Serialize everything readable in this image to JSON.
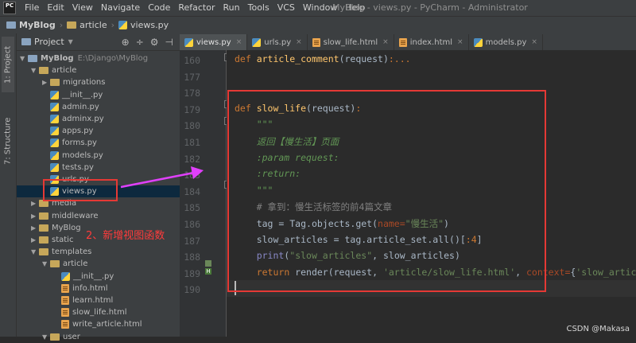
{
  "menubar": {
    "items": [
      "File",
      "Edit",
      "View",
      "Navigate",
      "Code",
      "Refactor",
      "Run",
      "Tools",
      "VCS",
      "Window",
      "Help"
    ],
    "window_title": "MyBlog - views.py - PyCharm - Administrator",
    "app_icon_label": "PC"
  },
  "navbar": {
    "crumbs": [
      "MyBlog",
      "article",
      "views.py"
    ]
  },
  "sidestrip": {
    "project_tab": "1: Project",
    "structure_tab": "7: Structure"
  },
  "project_panel": {
    "title": "Project",
    "tree": [
      {
        "label": "MyBlog",
        "hint": "E:\\Django\\MyBlog",
        "type": "folder",
        "expanded": true,
        "level": 0
      },
      {
        "label": "article",
        "type": "folder",
        "expanded": true,
        "level": 1
      },
      {
        "label": "migrations",
        "type": "folder",
        "expanded": false,
        "level": 2
      },
      {
        "label": "__init__.py",
        "type": "py",
        "level": 2
      },
      {
        "label": "admin.py",
        "type": "py",
        "level": 2
      },
      {
        "label": "adminx.py",
        "type": "py",
        "level": 2
      },
      {
        "label": "apps.py",
        "type": "py",
        "level": 2
      },
      {
        "label": "forms.py",
        "type": "py",
        "level": 2
      },
      {
        "label": "models.py",
        "type": "py",
        "level": 2
      },
      {
        "label": "tests.py",
        "type": "py",
        "level": 2
      },
      {
        "label": "urls.py",
        "type": "py",
        "level": 2
      },
      {
        "label": "views.py",
        "type": "py",
        "level": 2,
        "selected": true
      },
      {
        "label": "media",
        "type": "folder",
        "expanded": false,
        "level": 1
      },
      {
        "label": "middleware",
        "type": "folder",
        "expanded": false,
        "level": 1
      },
      {
        "label": "MyBlog",
        "type": "folder",
        "expanded": false,
        "level": 1
      },
      {
        "label": "static",
        "type": "folder",
        "expanded": false,
        "level": 1
      },
      {
        "label": "templates",
        "type": "folder",
        "expanded": true,
        "level": 1
      },
      {
        "label": "article",
        "type": "folder",
        "expanded": true,
        "level": 2
      },
      {
        "label": "__init__.py",
        "type": "py",
        "level": 3
      },
      {
        "label": "info.html",
        "type": "html",
        "level": 3
      },
      {
        "label": "learn.html",
        "type": "html",
        "level": 3
      },
      {
        "label": "slow_life.html",
        "type": "html",
        "level": 3
      },
      {
        "label": "write_article.html",
        "type": "html",
        "level": 3
      },
      {
        "label": "user",
        "type": "folder",
        "expanded": true,
        "level": 2
      }
    ]
  },
  "editor": {
    "tabs": [
      {
        "label": "views.py",
        "type": "py",
        "active": true
      },
      {
        "label": "urls.py",
        "type": "py",
        "active": false
      },
      {
        "label": "slow_life.html",
        "type": "html",
        "active": false
      },
      {
        "label": "index.html",
        "type": "html",
        "active": false
      },
      {
        "label": "models.py",
        "type": "py",
        "active": false
      }
    ],
    "line_numbers": [
      "160",
      "177",
      "178",
      "179",
      "180",
      "181",
      "182",
      "183",
      "184",
      "185",
      "186",
      "187",
      "188",
      "189",
      "190"
    ],
    "lines": [
      [
        {
          "t": "def ",
          "c": "kw"
        },
        {
          "t": "article_comment",
          "c": "fn"
        },
        {
          "t": "(request)",
          "c": ""
        },
        {
          "t": ":...",
          "c": "kw"
        }
      ],
      [],
      [],
      [
        {
          "t": "def ",
          "c": "kw"
        },
        {
          "t": "slow_life",
          "c": "fn"
        },
        {
          "t": "(request)",
          "c": ""
        },
        {
          "t": ":",
          "c": "kw"
        }
      ],
      [
        {
          "t": "    \"\"\"",
          "c": "doc"
        }
      ],
      [
        {
          "t": "    返回【慢生活】页面",
          "c": "doc"
        }
      ],
      [
        {
          "t": "    :param request:",
          "c": "doc"
        }
      ],
      [
        {
          "t": "    :return:",
          "c": "doc"
        }
      ],
      [
        {
          "t": "    \"\"\"",
          "c": "doc"
        }
      ],
      [
        {
          "t": "    # 拿到：慢生活标签的前4篇文章",
          "c": "cmt"
        }
      ],
      [
        {
          "t": "    tag ",
          "c": ""
        },
        {
          "t": "= ",
          "c": ""
        },
        {
          "t": "Tag.objects.get(",
          "c": ""
        },
        {
          "t": "name=",
          "c": "named"
        },
        {
          "t": "\"慢生活\"",
          "c": "str"
        },
        {
          "t": ")",
          "c": ""
        }
      ],
      [
        {
          "t": "    slow_articles = tag.article_set.all()[",
          "c": ""
        },
        {
          "t": ":4",
          "c": "kw"
        },
        {
          "t": "]",
          "c": ""
        }
      ],
      [
        {
          "t": "    ",
          "c": ""
        },
        {
          "t": "print",
          "c": "bi"
        },
        {
          "t": "(",
          "c": ""
        },
        {
          "t": "\"slow_articles\"",
          "c": "str"
        },
        {
          "t": ", slow_articles)",
          "c": ""
        }
      ],
      [
        {
          "t": "    ",
          "c": ""
        },
        {
          "t": "return ",
          "c": "kw"
        },
        {
          "t": "render(request, ",
          "c": ""
        },
        {
          "t": "'article/slow_life.html'",
          "c": "str"
        },
        {
          "t": ", ",
          "c": ""
        },
        {
          "t": "context=",
          "c": "named"
        },
        {
          "t": "{",
          "c": ""
        },
        {
          "t": "'slow_artic",
          "c": "str"
        }
      ],
      []
    ]
  },
  "annotation": {
    "text": "2、新增视图函数"
  },
  "watermark": "CSDN @Makasa"
}
